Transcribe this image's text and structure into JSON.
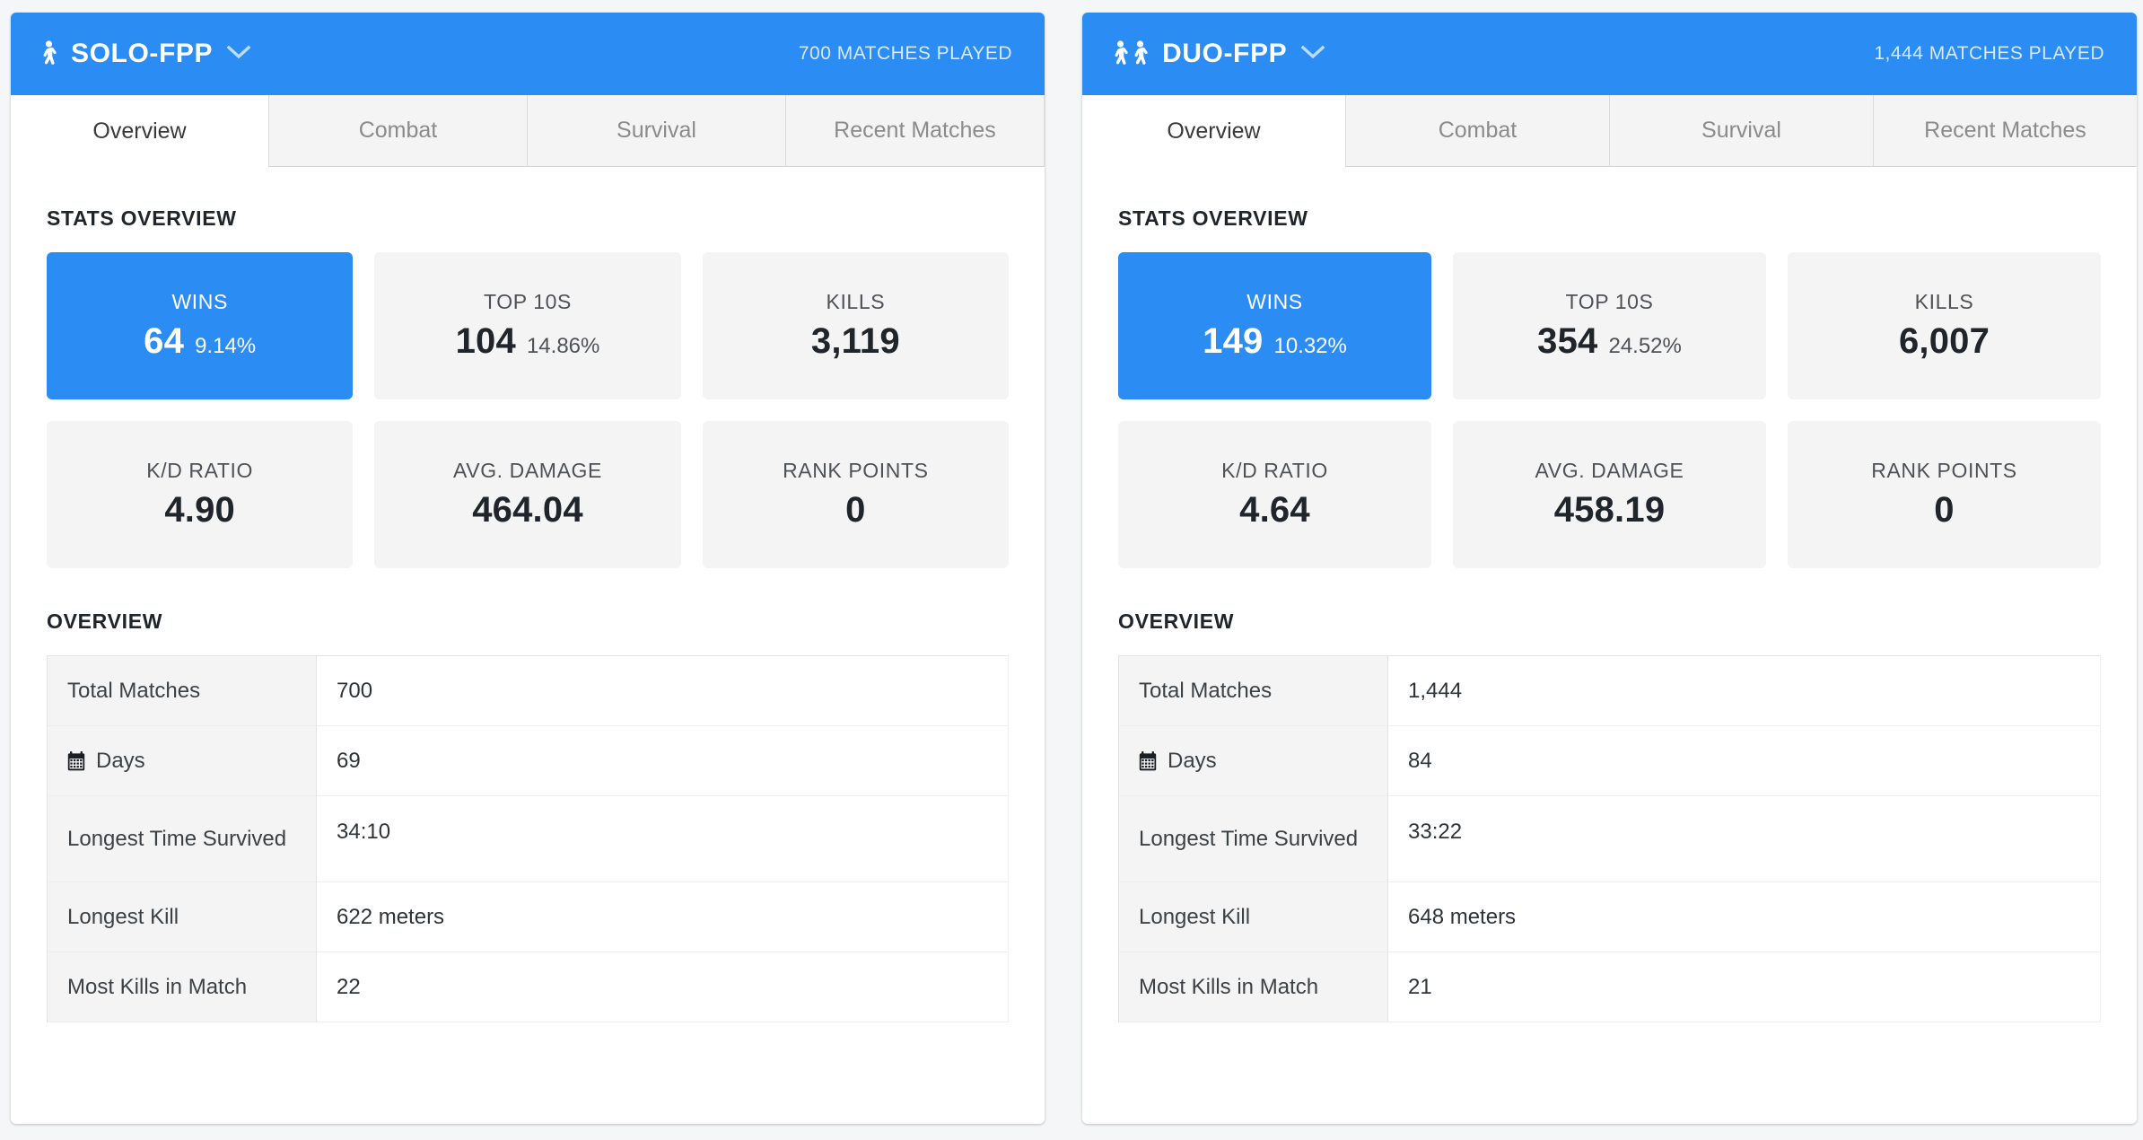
{
  "theme": {
    "accent": "#2b8cf4",
    "card_bg": "#f4f4f4",
    "page_bg": "#f5f6f7",
    "text": "#20252b"
  },
  "panels": [
    {
      "id": "solo-fpp",
      "mode_label": "SOLO-FPP",
      "mode_icon": "walking-person-icon",
      "player_count": 1,
      "dropdown_icon": "chevron-down-icon",
      "matches_played": "700 MATCHES PLAYED",
      "tabs": [
        {
          "label": "Overview",
          "active": true
        },
        {
          "label": "Combat",
          "active": false
        },
        {
          "label": "Survival",
          "active": false
        },
        {
          "label": "Recent Matches",
          "active": false
        }
      ],
      "stats_overview_title": "STATS OVERVIEW",
      "stats": [
        {
          "label": "WINS",
          "value": "64",
          "pct": "9.14%",
          "highlight": true
        },
        {
          "label": "TOP 10S",
          "value": "104",
          "pct": "14.86%",
          "highlight": false
        },
        {
          "label": "KILLS",
          "value": "3,119",
          "pct": "",
          "highlight": false
        },
        {
          "label": "K/D RATIO",
          "value": "4.90",
          "pct": "",
          "highlight": false
        },
        {
          "label": "AVG. DAMAGE",
          "value": "464.04",
          "pct": "",
          "highlight": false
        },
        {
          "label": "RANK POINTS",
          "value": "0",
          "pct": "",
          "highlight": false
        }
      ],
      "overview_title": "OVERVIEW",
      "overview_rows": [
        {
          "key": "Total Matches",
          "value": "700",
          "icon": "",
          "tall": false
        },
        {
          "key": "Days",
          "value": "69",
          "icon": "calendar-icon",
          "tall": false
        },
        {
          "key": "Longest Time Survived",
          "value": "34:10",
          "icon": "",
          "tall": true
        },
        {
          "key": "Longest Kill",
          "value": "622 meters",
          "icon": "",
          "tall": false
        },
        {
          "key": "Most Kills in Match",
          "value": "22",
          "icon": "",
          "tall": false
        }
      ]
    },
    {
      "id": "duo-fpp",
      "mode_label": "DUO-FPP",
      "mode_icon": "walking-people-icon",
      "player_count": 2,
      "dropdown_icon": "chevron-down-icon",
      "matches_played": "1,444 MATCHES PLAYED",
      "tabs": [
        {
          "label": "Overview",
          "active": true
        },
        {
          "label": "Combat",
          "active": false
        },
        {
          "label": "Survival",
          "active": false
        },
        {
          "label": "Recent Matches",
          "active": false
        }
      ],
      "stats_overview_title": "STATS OVERVIEW",
      "stats": [
        {
          "label": "WINS",
          "value": "149",
          "pct": "10.32%",
          "highlight": true
        },
        {
          "label": "TOP 10S",
          "value": "354",
          "pct": "24.52%",
          "highlight": false
        },
        {
          "label": "KILLS",
          "value": "6,007",
          "pct": "",
          "highlight": false
        },
        {
          "label": "K/D RATIO",
          "value": "4.64",
          "pct": "",
          "highlight": false
        },
        {
          "label": "AVG. DAMAGE",
          "value": "458.19",
          "pct": "",
          "highlight": false
        },
        {
          "label": "RANK POINTS",
          "value": "0",
          "pct": "",
          "highlight": false
        }
      ],
      "overview_title": "OVERVIEW",
      "overview_rows": [
        {
          "key": "Total Matches",
          "value": "1,444",
          "icon": "",
          "tall": false
        },
        {
          "key": "Days",
          "value": "84",
          "icon": "calendar-icon",
          "tall": false
        },
        {
          "key": "Longest Time Survived",
          "value": "33:22",
          "icon": "",
          "tall": true
        },
        {
          "key": "Longest Kill",
          "value": "648 meters",
          "icon": "",
          "tall": false
        },
        {
          "key": "Most Kills in Match",
          "value": "21",
          "icon": "",
          "tall": false
        }
      ]
    }
  ]
}
